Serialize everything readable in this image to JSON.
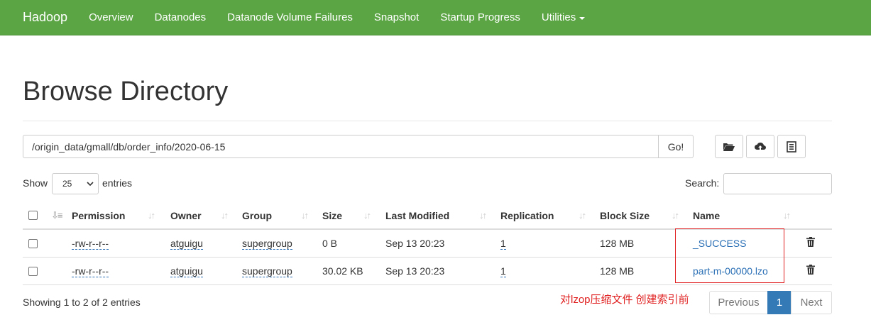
{
  "navbar": {
    "brand": "Hadoop",
    "items": [
      "Overview",
      "Datanodes",
      "Datanode Volume Failures",
      "Snapshot",
      "Startup Progress",
      "Utilities"
    ]
  },
  "page": {
    "title": "Browse Directory"
  },
  "path_bar": {
    "value": "/origin_data/gmall/db/order_info/2020-06-15",
    "go_label": "Go!"
  },
  "toolbar_icons": [
    "folder-open-icon",
    "cloud-upload-icon",
    "list-icon"
  ],
  "controls": {
    "show_label": "Show",
    "entries_value": "25",
    "entries_label": "entries",
    "search_label": "Search:"
  },
  "table": {
    "columns": [
      "Permission",
      "Owner",
      "Group",
      "Size",
      "Last Modified",
      "Replication",
      "Block Size",
      "Name"
    ],
    "rows": [
      {
        "permission": "-rw-r--r--",
        "owner": "atguigu",
        "group": "supergroup",
        "size": "0 B",
        "last_modified": "Sep 13 20:23",
        "replication": "1",
        "block_size": "128 MB",
        "name": "_SUCCESS"
      },
      {
        "permission": "-rw-r--r--",
        "owner": "atguigu",
        "group": "supergroup",
        "size": "30.02 KB",
        "last_modified": "Sep 13 20:23",
        "replication": "1",
        "block_size": "128 MB",
        "name": "part-m-00000.lzo"
      }
    ]
  },
  "annotation": "对lzop压缩文件 创建索引前",
  "footer": {
    "info": "Showing 1 to 2 of 2 entries",
    "pagination": {
      "previous": "Previous",
      "current": "1",
      "next": "Next"
    }
  },
  "colors": {
    "navbar": "#5ba544",
    "link": "#2a6fb5",
    "active_page": "#337ab7",
    "annotation": "#e02020"
  }
}
